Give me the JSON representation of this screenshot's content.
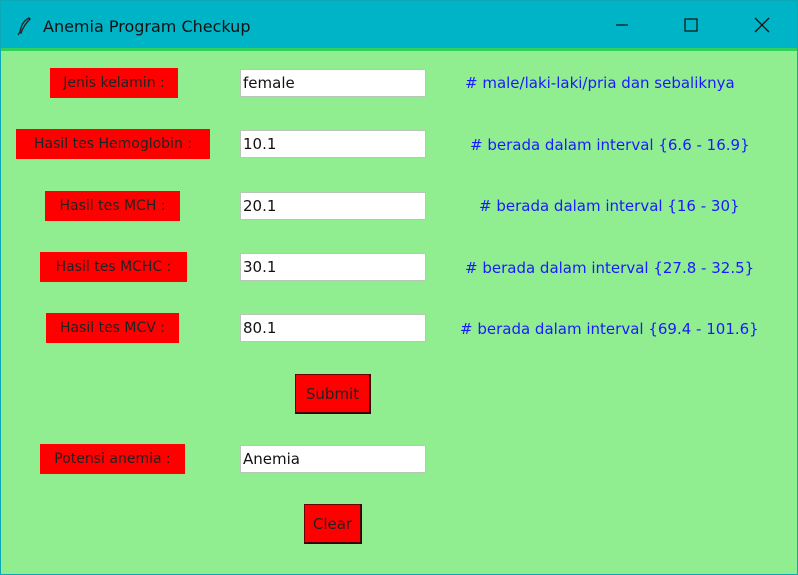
{
  "window": {
    "title": "Anemia Program Checkup",
    "background_color": "#90ee90",
    "titlebar_color": "#00b4c8",
    "controls": [
      "minimize-icon",
      "maximize-icon",
      "close-icon"
    ]
  },
  "form": {
    "rows": [
      {
        "label": "Jenis kelamin :",
        "value": "female",
        "hint": "# male/laki-laki/pria dan sebaliknya"
      },
      {
        "label": "Hasil tes Hemoglobin :",
        "value": "10.1",
        "hint": "# berada dalam interval {6.6 - 16.9}"
      },
      {
        "label": "Hasil tes MCH :",
        "value": "20.1",
        "hint": "# berada dalam interval {16 - 30}"
      },
      {
        "label": "Hasil tes MCHC :",
        "value": "30.1",
        "hint": "# berada dalam interval {27.8 - 32.5}"
      },
      {
        "label": "Hasil tes MCV :",
        "value": "80.1",
        "hint": "# berada dalam interval {69.4 - 101.6}"
      }
    ],
    "submit_label": "Submit",
    "result_label": "Potensi anemia :",
    "result_value": "Anemia",
    "clear_label": "Clear",
    "label_color": "#ff0000",
    "hint_color": "#1a1aff"
  }
}
